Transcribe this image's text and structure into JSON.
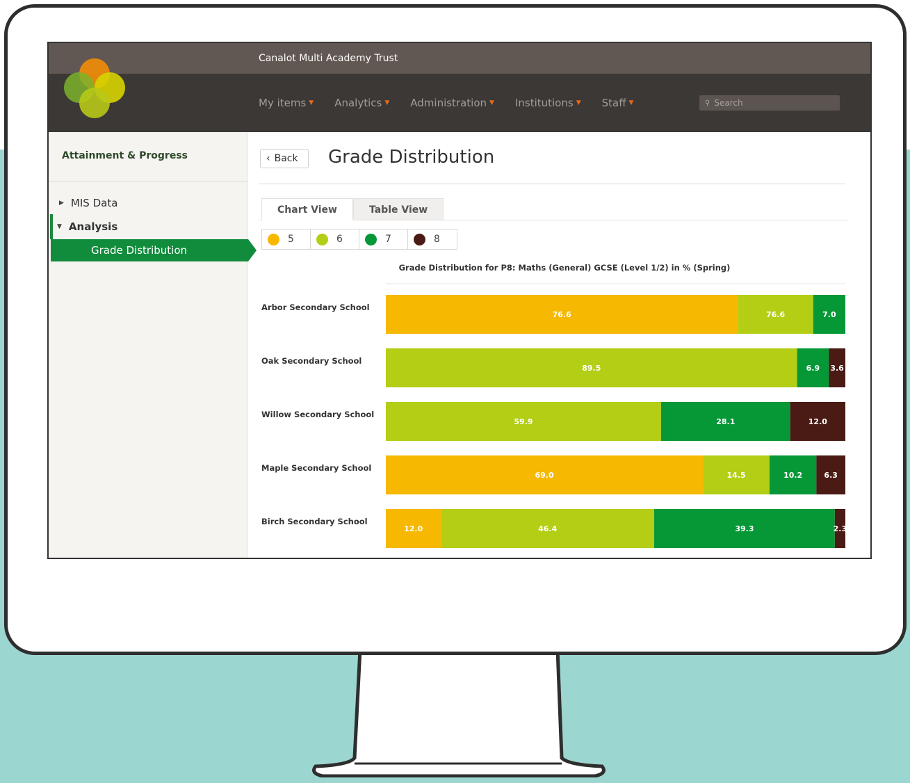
{
  "app": {
    "trust_name": "Canalot Multi Academy Trust",
    "nav": [
      {
        "label": "My items"
      },
      {
        "label": "Analytics"
      },
      {
        "label": "Administration"
      },
      {
        "label": "Institutions"
      },
      {
        "label": "Staff"
      }
    ],
    "search": {
      "placeholder": "Search"
    }
  },
  "sidebar": {
    "title": "Attainment & Progress",
    "items": [
      {
        "label": "MIS Data"
      },
      {
        "label": "Analysis"
      },
      {
        "label": "Grade Distribution"
      }
    ]
  },
  "main": {
    "back_label": "Back",
    "page_title": "Grade Distribution",
    "tabs": [
      {
        "label": "Chart View",
        "active": true
      },
      {
        "label": "Table View",
        "active": false
      }
    ]
  },
  "colors": {
    "grade_5": "#f6b800",
    "grade_6": "#b3ce14",
    "grade_7": "#069737",
    "grade_8": "#4a1a14",
    "accent": "#118c3c"
  },
  "chart_data": {
    "type": "bar",
    "orientation": "horizontal-stacked",
    "title": "Grade Distribution for P8: Maths (General) GCSE (Level 1/2) in % (Spring)",
    "categories": [
      "Arbor Secondary School",
      "Oak Secondary School",
      "Willow Secondary School",
      "Maple Secondary School",
      "Birch Secondary School"
    ],
    "series": [
      {
        "name": "5",
        "color": "#f6b800",
        "values": [
          76.6,
          0,
          0,
          69.0,
          12.0
        ]
      },
      {
        "name": "6",
        "color": "#b3ce14",
        "values": [
          16.4,
          89.5,
          59.9,
          14.5,
          46.4
        ]
      },
      {
        "name": "7",
        "color": "#069737",
        "values": [
          7.0,
          6.9,
          28.1,
          10.2,
          39.3
        ]
      },
      {
        "name": "8",
        "color": "#4a1a14",
        "values": [
          0,
          3.6,
          12.0,
          6.3,
          2.3
        ]
      }
    ],
    "data_labels": [
      [
        "76.6",
        "76.6",
        "7.0",
        ""
      ],
      [
        "",
        "89.5",
        "6.9",
        "3.6"
      ],
      [
        "",
        "59.9",
        "28.1",
        "12.0"
      ],
      [
        "69.0",
        "14.5",
        "10.2",
        "6.3"
      ],
      [
        "12.0",
        "46.4",
        "39.3",
        "2.3"
      ]
    ],
    "xlim": [
      0,
      100
    ],
    "legend": "top-left"
  }
}
